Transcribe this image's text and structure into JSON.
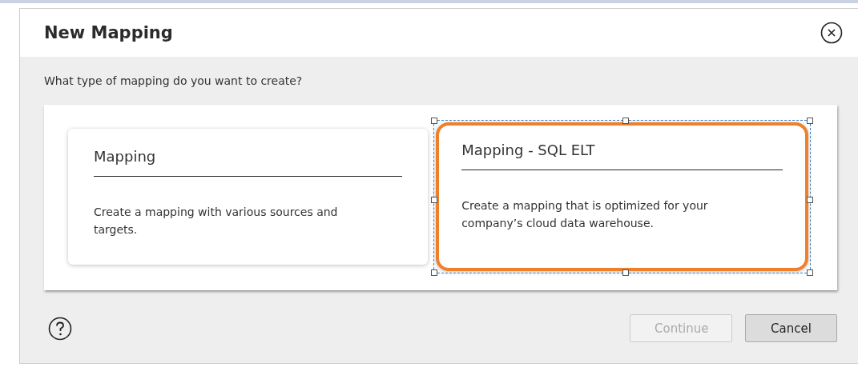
{
  "dialog": {
    "title": "New Mapping"
  },
  "question": "What type of mapping do you want to create?",
  "options": [
    {
      "title": "Mapping",
      "description": "Create a mapping with various sources and targets.",
      "selected": false
    },
    {
      "title": "Mapping - SQL ELT",
      "description": "Create a mapping that is optimized for your company’s cloud data warehouse.",
      "selected": true
    }
  ],
  "buttons": [
    {
      "label": "Continue",
      "kind": "primary",
      "disabled": true
    },
    {
      "label": "Cancel",
      "kind": "secondary",
      "disabled": false
    }
  ]
}
